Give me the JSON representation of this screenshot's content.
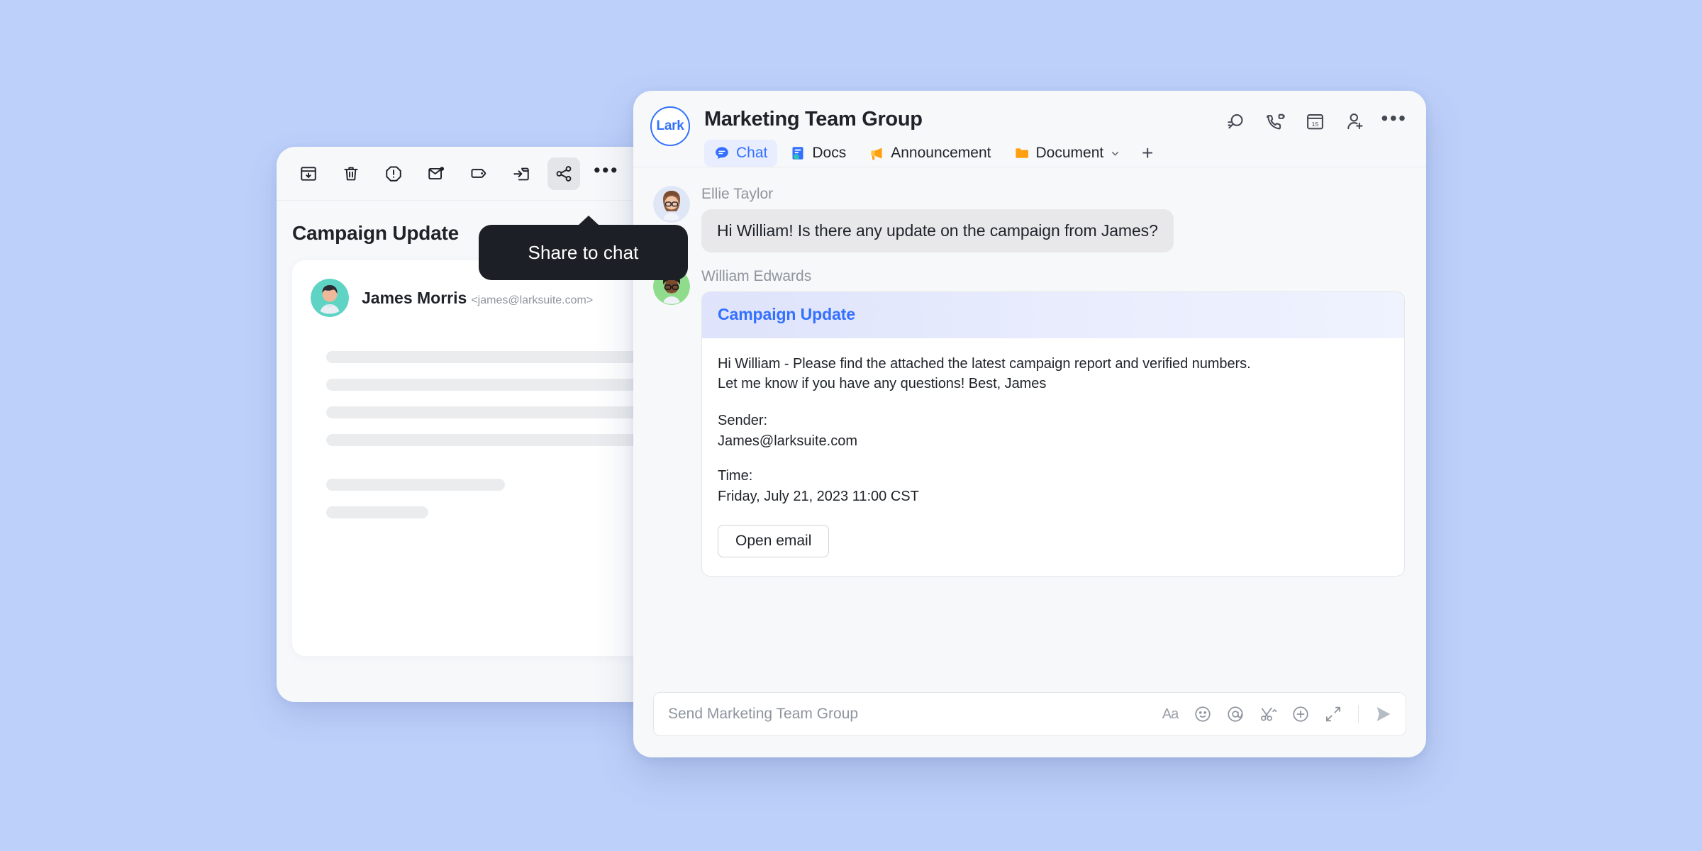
{
  "theme": {
    "page_background": "#bdd0fa",
    "accent_blue": "#3370ff",
    "panel_background": "#f7f8fa",
    "bubble_gray": "#e8e8ea",
    "tooltip_dark": "#1c2026",
    "card_header_gradient_from": "#dfe3fb",
    "card_header_gradient_to": "#eff3fe"
  },
  "email_window": {
    "toolbar": [
      {
        "name": "archive",
        "label": "Archive",
        "active": false
      },
      {
        "name": "delete",
        "label": "Delete",
        "active": false
      },
      {
        "name": "report-spam",
        "label": "Report spam",
        "active": false
      },
      {
        "name": "mark-unread",
        "label": "Mark as unread",
        "active": false
      },
      {
        "name": "label",
        "label": "Label",
        "active": false
      },
      {
        "name": "move-to-folder",
        "label": "Move to folder",
        "active": false
      },
      {
        "name": "share-to-chat",
        "label": "Share to chat",
        "active": true
      }
    ],
    "more_label": "More",
    "subject": "Campaign Update",
    "sender_name": "James Morris",
    "sender_email": "<james@larksuite.com>",
    "skeleton_widths": [
      "100%",
      "100%",
      "100%",
      "62%",
      "35%",
      "20%"
    ]
  },
  "tooltip": {
    "text": "Share to chat"
  },
  "chat_window": {
    "logo_text": "Lark",
    "title": "Marketing Team Group",
    "tabs": [
      {
        "label": "Chat",
        "icon": "chat-icon",
        "active": true
      },
      {
        "label": "Docs",
        "icon": "docs-icon",
        "active": false
      },
      {
        "label": "Announcement",
        "icon": "megaphone-icon",
        "active": false
      },
      {
        "label": "Document",
        "icon": "folder-icon",
        "active": false,
        "has_chevron": true
      }
    ],
    "add_tab_label": "+",
    "header_actions": [
      {
        "name": "search-icon",
        "label": "Search"
      },
      {
        "name": "video-call-icon",
        "label": "Call"
      },
      {
        "name": "calendar-icon",
        "label": "Calendar",
        "day": "15"
      },
      {
        "name": "add-member-icon",
        "label": "Add member"
      },
      {
        "name": "more-icon",
        "label": "More"
      }
    ],
    "messages": [
      {
        "sender": "Ellie Taylor",
        "type": "text",
        "text": "Hi William! Is there any update on the campaign from James?"
      },
      {
        "sender": "William Edwards",
        "type": "card",
        "card": {
          "title": "Campaign Update",
          "body_line_1": "Hi William - Please find the attached the latest campaign report and verified numbers.",
          "body_line_2": "Let me know if you have any questions! Best, James",
          "sender_label": "Sender:",
          "sender_value": "James@larksuite.com",
          "time_label": "Time:",
          "time_value": "Friday, July 21, 2023 11:00 CST",
          "button_label": "Open email"
        }
      }
    ],
    "composer": {
      "placeholder": "Send Marketing Team Group",
      "tools": [
        {
          "name": "text-format-icon",
          "label": "Aa"
        },
        {
          "name": "emoji-icon",
          "label": "Emoji"
        },
        {
          "name": "mention-icon",
          "label": "Mention"
        },
        {
          "name": "screenshot-icon",
          "label": "Screenshot"
        },
        {
          "name": "add-attachment-icon",
          "label": "More"
        },
        {
          "name": "expand-icon",
          "label": "Expand"
        },
        {
          "name": "send-icon",
          "label": "Send"
        }
      ]
    }
  }
}
